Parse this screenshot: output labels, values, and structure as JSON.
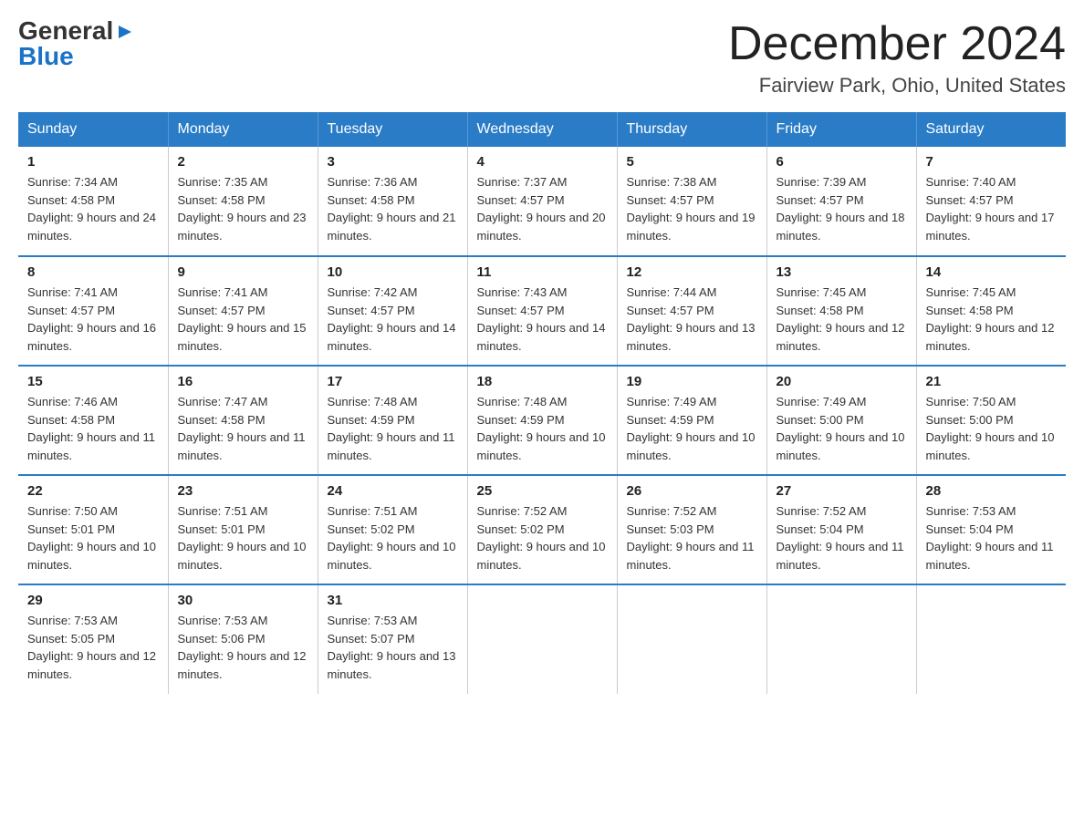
{
  "header": {
    "logo_text1": "General",
    "logo_text2": "Blue",
    "month_title": "December 2024",
    "location": "Fairview Park, Ohio, United States"
  },
  "weekdays": [
    "Sunday",
    "Monday",
    "Tuesday",
    "Wednesday",
    "Thursday",
    "Friday",
    "Saturday"
  ],
  "weeks": [
    [
      {
        "day": "1",
        "sunrise": "7:34 AM",
        "sunset": "4:58 PM",
        "daylight": "9 hours and 24 minutes."
      },
      {
        "day": "2",
        "sunrise": "7:35 AM",
        "sunset": "4:58 PM",
        "daylight": "9 hours and 23 minutes."
      },
      {
        "day": "3",
        "sunrise": "7:36 AM",
        "sunset": "4:58 PM",
        "daylight": "9 hours and 21 minutes."
      },
      {
        "day": "4",
        "sunrise": "7:37 AM",
        "sunset": "4:57 PM",
        "daylight": "9 hours and 20 minutes."
      },
      {
        "day": "5",
        "sunrise": "7:38 AM",
        "sunset": "4:57 PM",
        "daylight": "9 hours and 19 minutes."
      },
      {
        "day": "6",
        "sunrise": "7:39 AM",
        "sunset": "4:57 PM",
        "daylight": "9 hours and 18 minutes."
      },
      {
        "day": "7",
        "sunrise": "7:40 AM",
        "sunset": "4:57 PM",
        "daylight": "9 hours and 17 minutes."
      }
    ],
    [
      {
        "day": "8",
        "sunrise": "7:41 AM",
        "sunset": "4:57 PM",
        "daylight": "9 hours and 16 minutes."
      },
      {
        "day": "9",
        "sunrise": "7:41 AM",
        "sunset": "4:57 PM",
        "daylight": "9 hours and 15 minutes."
      },
      {
        "day": "10",
        "sunrise": "7:42 AM",
        "sunset": "4:57 PM",
        "daylight": "9 hours and 14 minutes."
      },
      {
        "day": "11",
        "sunrise": "7:43 AM",
        "sunset": "4:57 PM",
        "daylight": "9 hours and 14 minutes."
      },
      {
        "day": "12",
        "sunrise": "7:44 AM",
        "sunset": "4:57 PM",
        "daylight": "9 hours and 13 minutes."
      },
      {
        "day": "13",
        "sunrise": "7:45 AM",
        "sunset": "4:58 PM",
        "daylight": "9 hours and 12 minutes."
      },
      {
        "day": "14",
        "sunrise": "7:45 AM",
        "sunset": "4:58 PM",
        "daylight": "9 hours and 12 minutes."
      }
    ],
    [
      {
        "day": "15",
        "sunrise": "7:46 AM",
        "sunset": "4:58 PM",
        "daylight": "9 hours and 11 minutes."
      },
      {
        "day": "16",
        "sunrise": "7:47 AM",
        "sunset": "4:58 PM",
        "daylight": "9 hours and 11 minutes."
      },
      {
        "day": "17",
        "sunrise": "7:48 AM",
        "sunset": "4:59 PM",
        "daylight": "9 hours and 11 minutes."
      },
      {
        "day": "18",
        "sunrise": "7:48 AM",
        "sunset": "4:59 PM",
        "daylight": "9 hours and 10 minutes."
      },
      {
        "day": "19",
        "sunrise": "7:49 AM",
        "sunset": "4:59 PM",
        "daylight": "9 hours and 10 minutes."
      },
      {
        "day": "20",
        "sunrise": "7:49 AM",
        "sunset": "5:00 PM",
        "daylight": "9 hours and 10 minutes."
      },
      {
        "day": "21",
        "sunrise": "7:50 AM",
        "sunset": "5:00 PM",
        "daylight": "9 hours and 10 minutes."
      }
    ],
    [
      {
        "day": "22",
        "sunrise": "7:50 AM",
        "sunset": "5:01 PM",
        "daylight": "9 hours and 10 minutes."
      },
      {
        "day": "23",
        "sunrise": "7:51 AM",
        "sunset": "5:01 PM",
        "daylight": "9 hours and 10 minutes."
      },
      {
        "day": "24",
        "sunrise": "7:51 AM",
        "sunset": "5:02 PM",
        "daylight": "9 hours and 10 minutes."
      },
      {
        "day": "25",
        "sunrise": "7:52 AM",
        "sunset": "5:02 PM",
        "daylight": "9 hours and 10 minutes."
      },
      {
        "day": "26",
        "sunrise": "7:52 AM",
        "sunset": "5:03 PM",
        "daylight": "9 hours and 11 minutes."
      },
      {
        "day": "27",
        "sunrise": "7:52 AM",
        "sunset": "5:04 PM",
        "daylight": "9 hours and 11 minutes."
      },
      {
        "day": "28",
        "sunrise": "7:53 AM",
        "sunset": "5:04 PM",
        "daylight": "9 hours and 11 minutes."
      }
    ],
    [
      {
        "day": "29",
        "sunrise": "7:53 AM",
        "sunset": "5:05 PM",
        "daylight": "9 hours and 12 minutes."
      },
      {
        "day": "30",
        "sunrise": "7:53 AM",
        "sunset": "5:06 PM",
        "daylight": "9 hours and 12 minutes."
      },
      {
        "day": "31",
        "sunrise": "7:53 AM",
        "sunset": "5:07 PM",
        "daylight": "9 hours and 13 minutes."
      },
      null,
      null,
      null,
      null
    ]
  ]
}
